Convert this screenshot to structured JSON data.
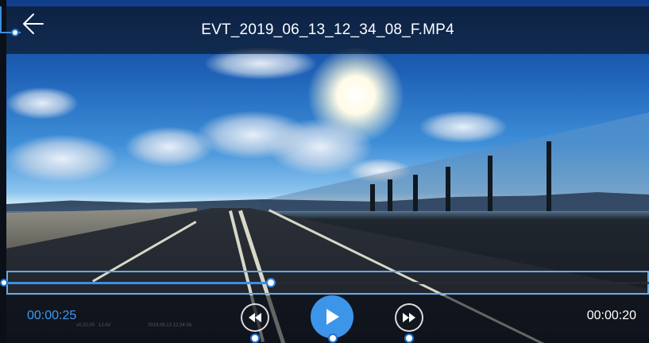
{
  "header": {
    "file_name": "EVT_2019_06_13_12_34_08_F.MP4",
    "back_icon": "arrow-left-icon"
  },
  "player": {
    "elapsed_time": "00:00:25",
    "remaining_time": "00:00:20",
    "progress_fraction": 0.41,
    "overlay_version": "v0.20.00",
    "overlay_voltage": "12.6V",
    "overlay_timestamp": "2019.06.13 12:34:08"
  },
  "controls": {
    "rewind_icon": "rewind-icon",
    "play_icon": "play-icon",
    "fast_forward_icon": "fast-forward-icon"
  },
  "colors": {
    "accent": "#3d95ea",
    "elapsed_text": "#3d9cf2",
    "annotation": "#1f74d0"
  }
}
